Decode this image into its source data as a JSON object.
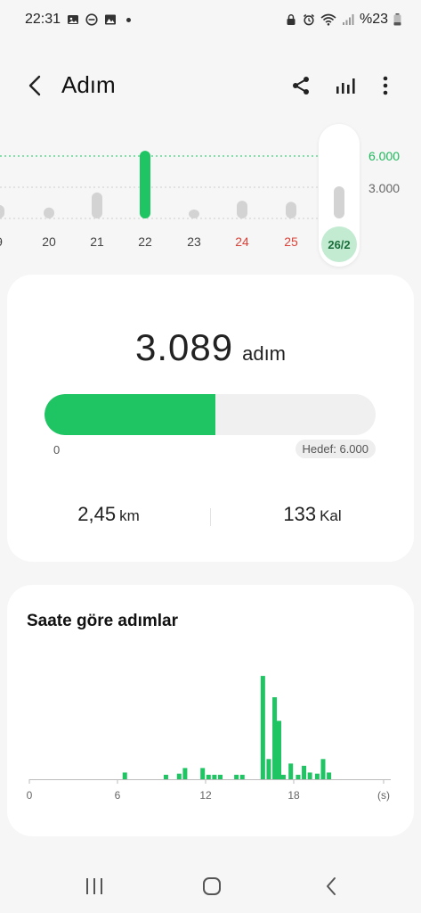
{
  "status_bar": {
    "time": "22:31",
    "battery": "%23",
    "left_icons": [
      "image-icon",
      "dnd-icon",
      "gallery-icon"
    ],
    "right_icons": [
      "lock-icon",
      "alarm-icon",
      "wifi-icon",
      "signal-icon",
      "battery-icon"
    ]
  },
  "header": {
    "title": "Adım",
    "icons": [
      "back-arrow-icon",
      "share-icon",
      "bar-chart-icon",
      "more-vert-icon"
    ]
  },
  "week": {
    "days": [
      {
        "label": "9",
        "steps": 1300,
        "weekend": false
      },
      {
        "label": "20",
        "steps": 1050,
        "weekend": false
      },
      {
        "label": "21",
        "steps": 2500,
        "weekend": false
      },
      {
        "label": "22",
        "steps": 6500,
        "weekend": false,
        "goal_reached": true
      },
      {
        "label": "23",
        "steps": 500,
        "weekend": false
      },
      {
        "label": "24",
        "steps": 1700,
        "weekend": true
      },
      {
        "label": "25",
        "steps": 1600,
        "weekend": true
      },
      {
        "label": "26/2",
        "steps": 3089,
        "weekend": false,
        "selected": true
      }
    ],
    "goal_label": "6.000",
    "mid_label": "3.000",
    "ymax": 6000
  },
  "summary": {
    "steps": "3.089",
    "steps_unit": "adım",
    "progress": 0.515,
    "zero_label": "0",
    "goal_label": "Hedef: 6.000",
    "distance": "2,45",
    "distance_unit": "km",
    "calories": "133",
    "calories_unit": "Kal"
  },
  "hourly": {
    "title": "Saate göre adımlar",
    "x_ticks": [
      "0",
      "6",
      "12",
      "18",
      "(s)"
    ],
    "colors": {
      "bar": "#1fc463",
      "axis": "#bbbbbb"
    }
  },
  "chart_data": {
    "type": "bar",
    "title": "Saate göre adımlar",
    "xlabel": "(s)",
    "ylabel": "",
    "xlim": [
      0,
      24
    ],
    "x": [
      6.5,
      9.3,
      10.2,
      10.6,
      11.8,
      12.2,
      12.6,
      13.0,
      14.1,
      14.5,
      15.9,
      16.3,
      16.7,
      17.0,
      17.3,
      17.8,
      18.3,
      18.7,
      19.1,
      19.6,
      20.0,
      20.4
    ],
    "values": [
      6,
      4,
      5,
      10,
      10,
      4,
      4,
      4,
      4,
      4,
      92,
      18,
      73,
      52,
      4,
      14,
      4,
      12,
      6,
      5,
      18,
      6
    ],
    "colors": {
      "bar": "#1fc463"
    }
  },
  "navbar": {
    "icons": [
      "recents-icon",
      "home-icon",
      "back-icon"
    ]
  }
}
